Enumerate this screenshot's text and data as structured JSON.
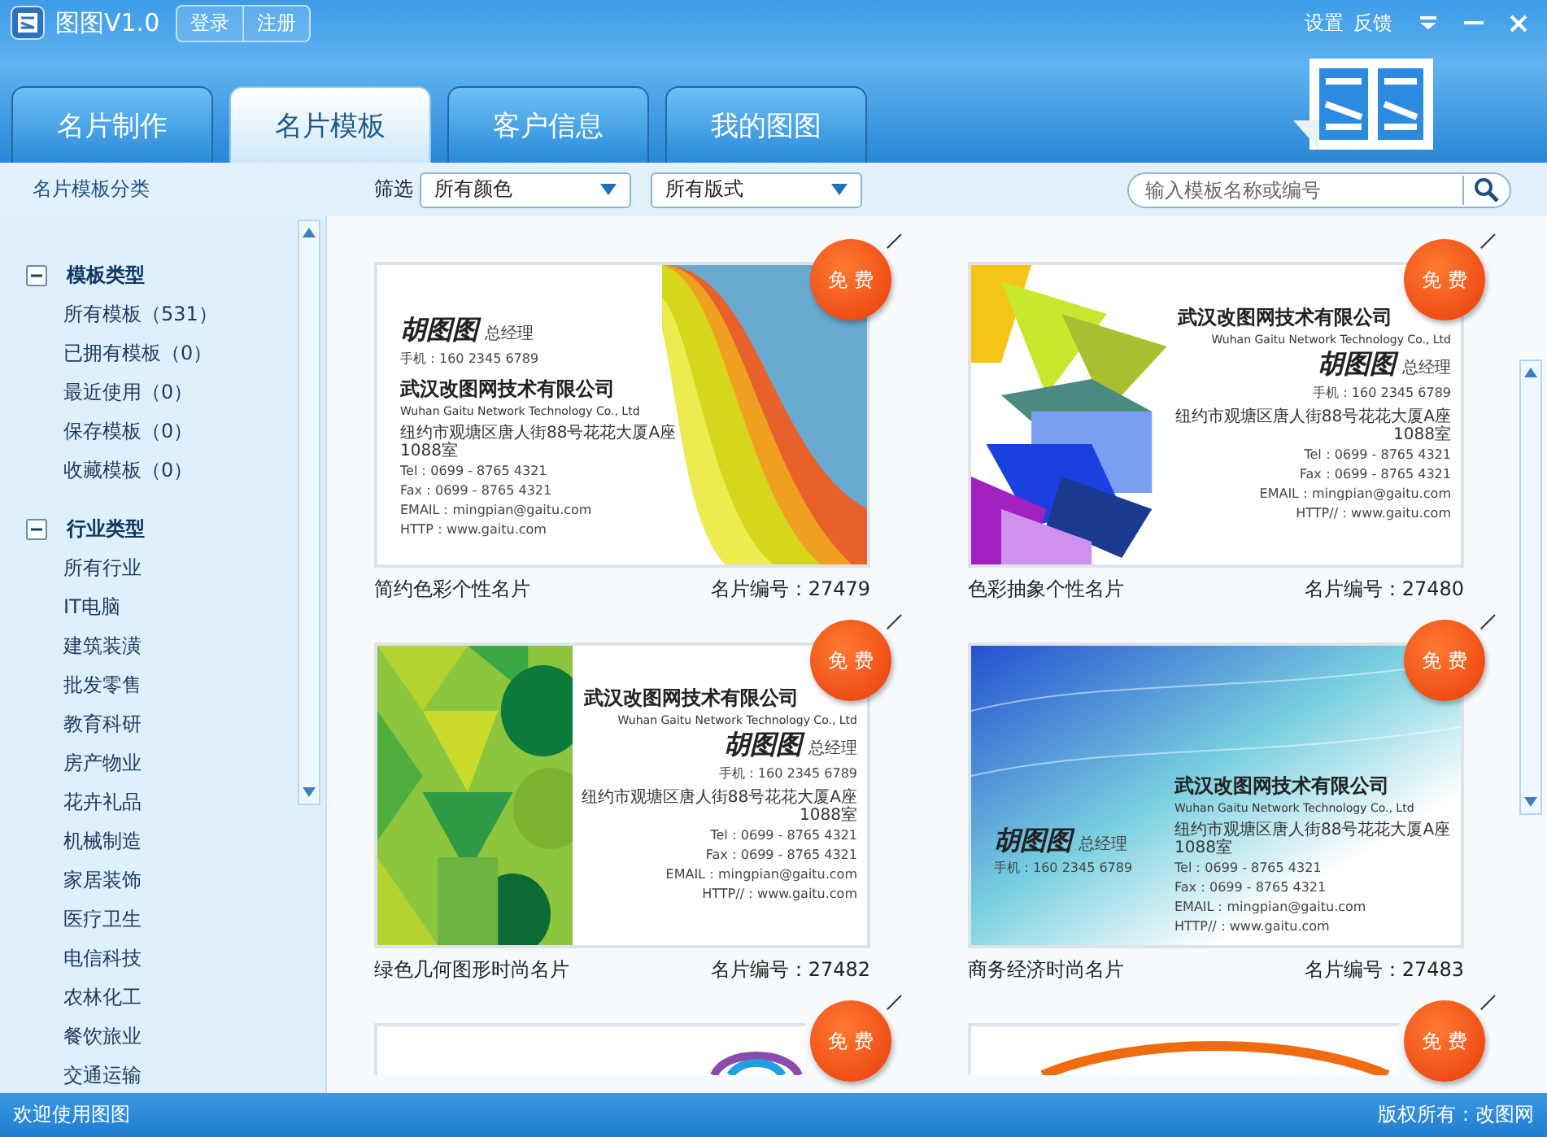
{
  "app": {
    "title": "图图V1.0",
    "auth_buttons": [
      "登录",
      "注册"
    ],
    "links": [
      "设置",
      "反馈"
    ]
  },
  "tabs": [
    {
      "label": "名片制作",
      "selected": false
    },
    {
      "label": "名片模板",
      "selected": true
    },
    {
      "label": "客户信息",
      "selected": false
    },
    {
      "label": "我的图图",
      "selected": false
    }
  ],
  "toolbar": {
    "section_title": "名片模板分类",
    "filter_label": "筛选",
    "filters": [
      {
        "value": "所有颜色"
      },
      {
        "value": "所有版式"
      }
    ],
    "search": {
      "placeholder": "输入模板名称或编号"
    }
  },
  "sidebar": {
    "groups": [
      {
        "label": "模板类型",
        "expanded": true,
        "children": [
          {
            "label": "所有模板（531）"
          },
          {
            "label": "已拥有模板（0）"
          },
          {
            "label": "最近使用（0）"
          },
          {
            "label": "保存模板（0）"
          },
          {
            "label": "收藏模板（0）"
          }
        ]
      },
      {
        "label": "行业类型",
        "expanded": true,
        "children": [
          {
            "label": "所有行业"
          },
          {
            "label": "IT电脑"
          },
          {
            "label": "建筑装潢"
          },
          {
            "label": "批发零售"
          },
          {
            "label": "教育科研"
          },
          {
            "label": "房产物业"
          },
          {
            "label": "花卉礼品"
          },
          {
            "label": "机械制造"
          },
          {
            "label": "家居装饰"
          },
          {
            "label": "医疗卫生"
          },
          {
            "label": "电信科技"
          },
          {
            "label": "农林化工"
          },
          {
            "label": "餐饮旅业"
          },
          {
            "label": "交通运输"
          }
        ]
      }
    ]
  },
  "templates": [
    {
      "kind": "waves",
      "badge": "免 费",
      "name": "简约色彩个性名片",
      "code": "名片编号：27479",
      "card": {
        "kind": "name-first",
        "name": "胡图图",
        "title": "总经理",
        "phone": "手机：160 2345 6789",
        "company": "武汉改图网技术有限公司",
        "company_en": "Wuhan Gaitu Network Technology Co., Ltd",
        "address": "纽约市观塘区唐人街88号花花大厦A座1088室",
        "tel": "Tel：0699 - 8765 4321",
        "fax": "Fax：0699 - 8765 4321",
        "email": "EMAIL：mingpian@gaitu.com",
        "web": "HTTP：www.gaitu.com"
      }
    },
    {
      "kind": "arrows",
      "badge": "免 费",
      "name": "色彩抽象个性名片",
      "code": "名片编号：27480",
      "card": {
        "kind": "company-first",
        "name": "胡图图",
        "title": "总经理",
        "phone": "手机：160 2345 6789",
        "company": "武汉改图网技术有限公司",
        "company_en": "Wuhan Gaitu Network Technology Co., Ltd",
        "address": "纽约市观塘区唐人街88号花花大厦A座1088室",
        "tel": "Tel：0699 - 8765 4321",
        "fax": "Fax：0699 - 8765 4321",
        "email": "EMAIL：mingpian@gaitu.com",
        "web": "HTTP//：www.gaitu.com"
      }
    },
    {
      "kind": "geometric",
      "badge": "免 费",
      "name": "绿色几何图形时尚名片",
      "code": "名片编号：27482",
      "card": {
        "kind": "company-first",
        "name": "胡图图",
        "title": "总经理",
        "phone": "手机：160 2345 6789",
        "company": "武汉改图网技术有限公司",
        "company_en": "Wuhan Gaitu Network Technology Co., Ltd",
        "address": "纽约市观塘区唐人街88号花花大厦A座1088室",
        "tel": "Tel：0699 - 8765 4321",
        "fax": "Fax：0699 - 8765 4321",
        "email": "EMAIL：mingpian@gaitu.com",
        "web": "HTTP//：www.gaitu.com"
      }
    },
    {
      "kind": "binary",
      "badge": "免 费",
      "name": "商务经济时尚名片",
      "code": "名片编号：27483",
      "card": {
        "kind": "split",
        "name": "胡图图",
        "title": "总经理",
        "phone": "手机：160 2345 6789",
        "company": "武汉改图网技术有限公司",
        "company_en": "Wuhan Gaitu Network Technology Co., Ltd",
        "address": "纽约市观塘区唐人街88号花花大厦A座1088室",
        "tel": "Tel：0699 - 8765 4321",
        "fax": "Fax：0699 - 8765 4321",
        "email": "EMAIL：mingpian@gaitu.com",
        "web": "HTTP//：www.gaitu.com"
      }
    },
    {
      "kind": "rings",
      "badge": "免 费"
    },
    {
      "kind": "arc",
      "badge": "免 费"
    }
  ],
  "status_bar": {
    "welcome": "欢迎使用图图",
    "copyright": "版权所有：改图网"
  }
}
